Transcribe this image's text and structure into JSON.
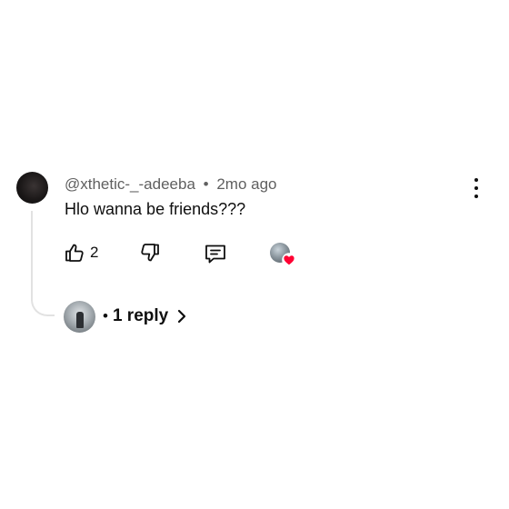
{
  "comment": {
    "author": "@xthetic-_-adeeba",
    "separator": "•",
    "time": "2mo ago",
    "text": "Hlo wanna be friends???",
    "like_count": "2",
    "icons": {
      "avatar": "user-avatar",
      "more": "more-vertical-icon",
      "like": "thumbs-up-icon",
      "dislike": "thumbs-down-icon",
      "reply": "comment-icon",
      "creator_heart": "creator-heart-icon"
    },
    "colors": {
      "heart": "#ff0033",
      "meta_text": "#606060",
      "text": "#0f0f0f"
    }
  },
  "replies": {
    "separator": "•",
    "label": "1 reply",
    "icon": "chevron-right-icon"
  }
}
